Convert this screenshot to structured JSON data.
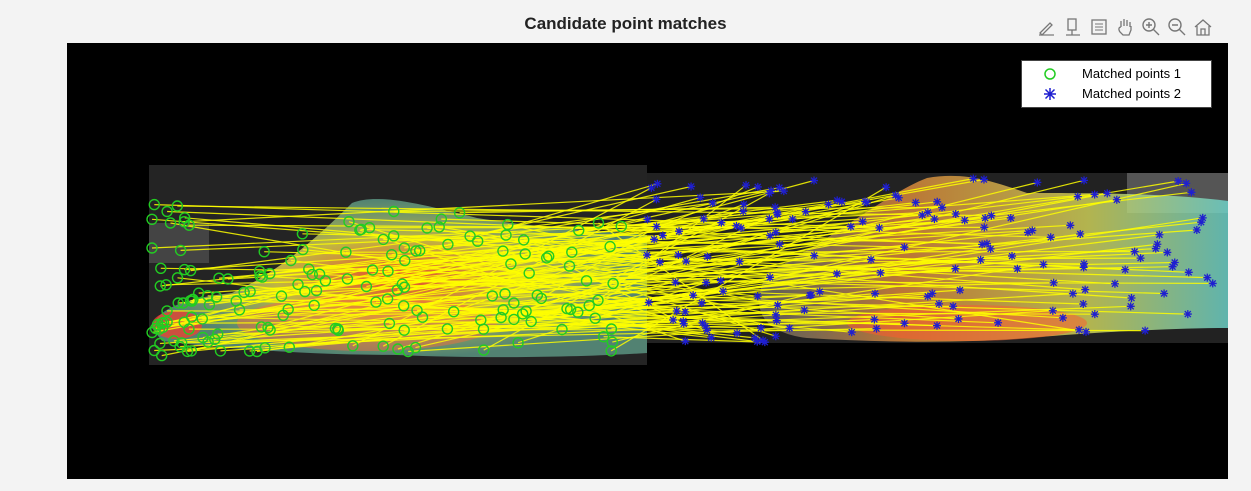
{
  "figure": {
    "title": "Candidate point matches"
  },
  "toolbar": {
    "tools": [
      {
        "name": "brush-tool-icon",
        "tooltip": "Brush"
      },
      {
        "name": "data-tips-icon",
        "tooltip": "Data Tips"
      },
      {
        "name": "rotate-icon",
        "tooltip": "Restore"
      },
      {
        "name": "pan-icon",
        "tooltip": "Pan"
      },
      {
        "name": "zoom-in-icon",
        "tooltip": "Zoom In"
      },
      {
        "name": "zoom-out-icon",
        "tooltip": "Zoom Out"
      },
      {
        "name": "home-icon",
        "tooltip": "Restore View"
      }
    ]
  },
  "legend": {
    "entries": [
      {
        "label": "Matched points 1",
        "marker": "circle",
        "color": "#22cc22"
      },
      {
        "label": "Matched points 2",
        "marker": "asterisk",
        "color": "#1f1fd0"
      }
    ]
  },
  "colors": {
    "axes_background": "#000000",
    "match_line": "#ffff00",
    "points1": "#22cc22",
    "points2": "#1f1fd0"
  }
}
